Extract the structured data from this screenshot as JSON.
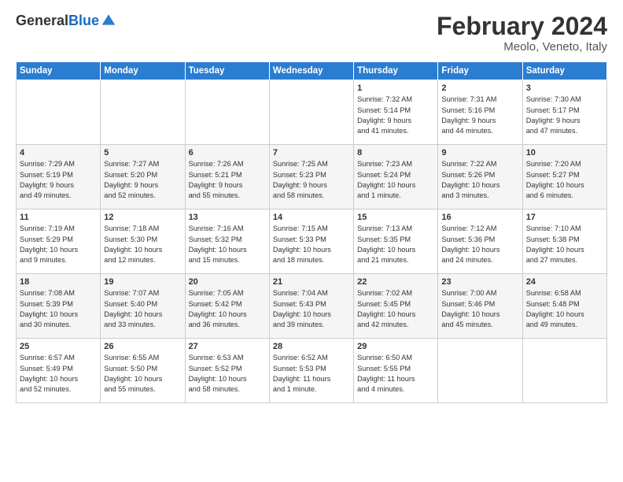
{
  "header": {
    "logo_general": "General",
    "logo_blue": "Blue",
    "title": "February 2024",
    "subtitle": "Meolo, Veneto, Italy"
  },
  "columns": [
    "Sunday",
    "Monday",
    "Tuesday",
    "Wednesday",
    "Thursday",
    "Friday",
    "Saturday"
  ],
  "weeks": [
    {
      "days": [
        {
          "num": "",
          "info": ""
        },
        {
          "num": "",
          "info": ""
        },
        {
          "num": "",
          "info": ""
        },
        {
          "num": "",
          "info": ""
        },
        {
          "num": "1",
          "info": "Sunrise: 7:32 AM\nSunset: 5:14 PM\nDaylight: 9 hours\nand 41 minutes."
        },
        {
          "num": "2",
          "info": "Sunrise: 7:31 AM\nSunset: 5:16 PM\nDaylight: 9 hours\nand 44 minutes."
        },
        {
          "num": "3",
          "info": "Sunrise: 7:30 AM\nSunset: 5:17 PM\nDaylight: 9 hours\nand 47 minutes."
        }
      ]
    },
    {
      "days": [
        {
          "num": "4",
          "info": "Sunrise: 7:29 AM\nSunset: 5:19 PM\nDaylight: 9 hours\nand 49 minutes."
        },
        {
          "num": "5",
          "info": "Sunrise: 7:27 AM\nSunset: 5:20 PM\nDaylight: 9 hours\nand 52 minutes."
        },
        {
          "num": "6",
          "info": "Sunrise: 7:26 AM\nSunset: 5:21 PM\nDaylight: 9 hours\nand 55 minutes."
        },
        {
          "num": "7",
          "info": "Sunrise: 7:25 AM\nSunset: 5:23 PM\nDaylight: 9 hours\nand 58 minutes."
        },
        {
          "num": "8",
          "info": "Sunrise: 7:23 AM\nSunset: 5:24 PM\nDaylight: 10 hours\nand 1 minute."
        },
        {
          "num": "9",
          "info": "Sunrise: 7:22 AM\nSunset: 5:26 PM\nDaylight: 10 hours\nand 3 minutes."
        },
        {
          "num": "10",
          "info": "Sunrise: 7:20 AM\nSunset: 5:27 PM\nDaylight: 10 hours\nand 6 minutes."
        }
      ]
    },
    {
      "days": [
        {
          "num": "11",
          "info": "Sunrise: 7:19 AM\nSunset: 5:29 PM\nDaylight: 10 hours\nand 9 minutes."
        },
        {
          "num": "12",
          "info": "Sunrise: 7:18 AM\nSunset: 5:30 PM\nDaylight: 10 hours\nand 12 minutes."
        },
        {
          "num": "13",
          "info": "Sunrise: 7:16 AM\nSunset: 5:32 PM\nDaylight: 10 hours\nand 15 minutes."
        },
        {
          "num": "14",
          "info": "Sunrise: 7:15 AM\nSunset: 5:33 PM\nDaylight: 10 hours\nand 18 minutes."
        },
        {
          "num": "15",
          "info": "Sunrise: 7:13 AM\nSunset: 5:35 PM\nDaylight: 10 hours\nand 21 minutes."
        },
        {
          "num": "16",
          "info": "Sunrise: 7:12 AM\nSunset: 5:36 PM\nDaylight: 10 hours\nand 24 minutes."
        },
        {
          "num": "17",
          "info": "Sunrise: 7:10 AM\nSunset: 5:38 PM\nDaylight: 10 hours\nand 27 minutes."
        }
      ]
    },
    {
      "days": [
        {
          "num": "18",
          "info": "Sunrise: 7:08 AM\nSunset: 5:39 PM\nDaylight: 10 hours\nand 30 minutes."
        },
        {
          "num": "19",
          "info": "Sunrise: 7:07 AM\nSunset: 5:40 PM\nDaylight: 10 hours\nand 33 minutes."
        },
        {
          "num": "20",
          "info": "Sunrise: 7:05 AM\nSunset: 5:42 PM\nDaylight: 10 hours\nand 36 minutes."
        },
        {
          "num": "21",
          "info": "Sunrise: 7:04 AM\nSunset: 5:43 PM\nDaylight: 10 hours\nand 39 minutes."
        },
        {
          "num": "22",
          "info": "Sunrise: 7:02 AM\nSunset: 5:45 PM\nDaylight: 10 hours\nand 42 minutes."
        },
        {
          "num": "23",
          "info": "Sunrise: 7:00 AM\nSunset: 5:46 PM\nDaylight: 10 hours\nand 45 minutes."
        },
        {
          "num": "24",
          "info": "Sunrise: 6:58 AM\nSunset: 5:48 PM\nDaylight: 10 hours\nand 49 minutes."
        }
      ]
    },
    {
      "days": [
        {
          "num": "25",
          "info": "Sunrise: 6:57 AM\nSunset: 5:49 PM\nDaylight: 10 hours\nand 52 minutes."
        },
        {
          "num": "26",
          "info": "Sunrise: 6:55 AM\nSunset: 5:50 PM\nDaylight: 10 hours\nand 55 minutes."
        },
        {
          "num": "27",
          "info": "Sunrise: 6:53 AM\nSunset: 5:52 PM\nDaylight: 10 hours\nand 58 minutes."
        },
        {
          "num": "28",
          "info": "Sunrise: 6:52 AM\nSunset: 5:53 PM\nDaylight: 11 hours\nand 1 minute."
        },
        {
          "num": "29",
          "info": "Sunrise: 6:50 AM\nSunset: 5:55 PM\nDaylight: 11 hours\nand 4 minutes."
        },
        {
          "num": "",
          "info": ""
        },
        {
          "num": "",
          "info": ""
        }
      ]
    }
  ]
}
